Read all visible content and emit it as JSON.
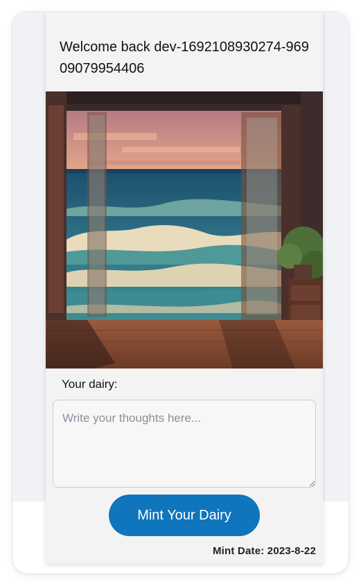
{
  "welcome": {
    "text": "Welcome back dev-1692108930274-96909079954406"
  },
  "hero": {
    "alt": "Pixel-art view of ocean waves through an open doorway",
    "colors": {
      "sky": "#d79a86",
      "sea": "#2d6f85",
      "foam": "#e8dcbc",
      "floor": "#8a4f36"
    }
  },
  "dairy": {
    "label": "Your dairy:",
    "placeholder": "Write your thoughts here...",
    "value": ""
  },
  "actions": {
    "mint_label": "Mint Your Dairy",
    "mint_color": "#0f75bc"
  },
  "footer": {
    "mint_date": "Mint Date: 2023-8-22"
  }
}
